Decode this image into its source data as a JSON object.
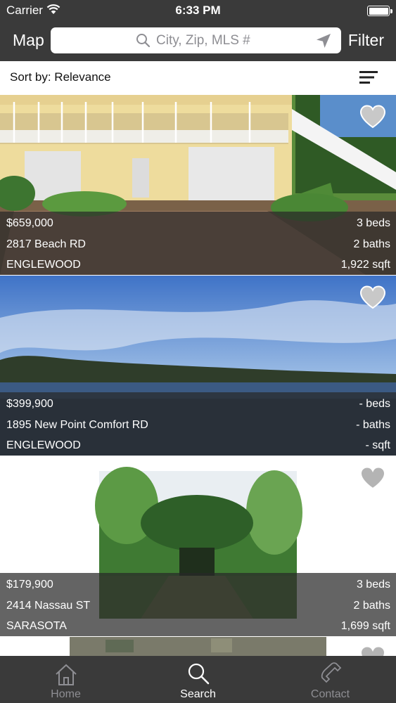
{
  "status_bar": {
    "carrier": "Carrier",
    "time": "6:33 PM"
  },
  "nav": {
    "map_label": "Map",
    "filter_label": "Filter",
    "search_placeholder": "City, Zip, MLS #"
  },
  "sort": {
    "label": "Sort by: Relevance"
  },
  "listings": [
    {
      "price": "$659,000",
      "address": "2817 Beach RD",
      "city": "ENGLEWOOD",
      "beds": "3 beds",
      "baths": "2 baths",
      "sqft": "1,922 sqft"
    },
    {
      "price": "$399,900",
      "address": "1895 New Point Comfort RD",
      "city": "ENGLEWOOD",
      "beds": "- beds",
      "baths": "- baths",
      "sqft": "- sqft"
    },
    {
      "price": "$179,900",
      "address": "2414 Nassau ST",
      "city": "SARASOTA",
      "beds": "3 beds",
      "baths": "2 baths",
      "sqft": "1,699 sqft"
    }
  ],
  "tabs": [
    {
      "label": "Home",
      "icon": "home-icon"
    },
    {
      "label": "Search",
      "icon": "search-icon"
    },
    {
      "label": "Contact",
      "icon": "phone-icon"
    }
  ],
  "colors": {
    "bar_background": "#3a3a3a",
    "inactive_tab": "#8e8e93",
    "active_tab": "#ffffff"
  }
}
